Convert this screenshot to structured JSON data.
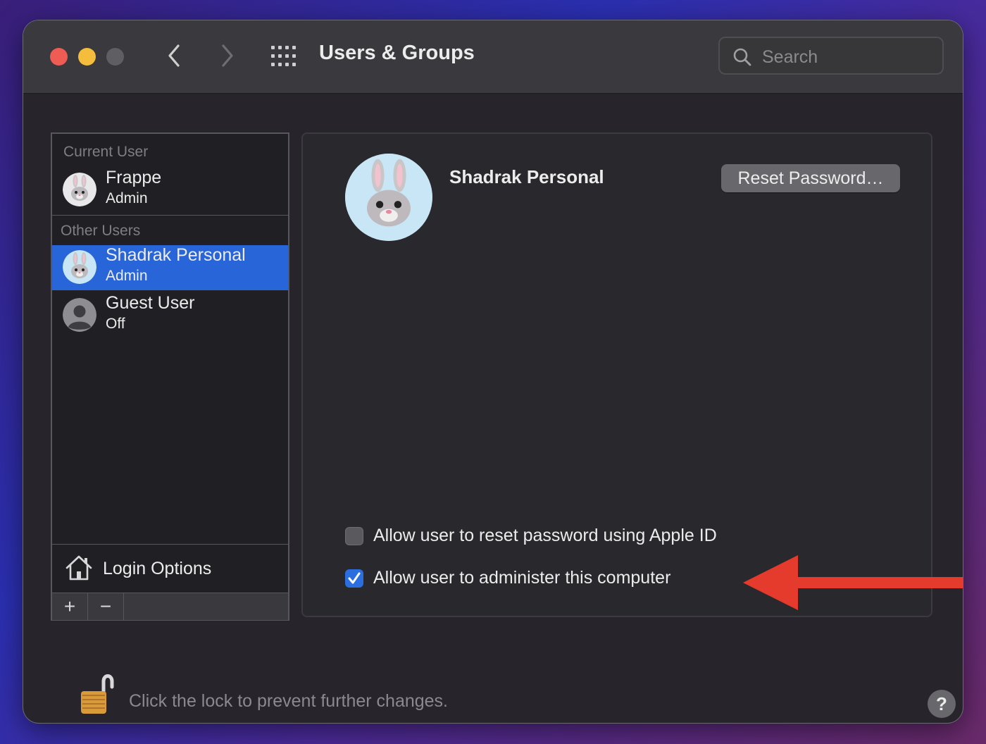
{
  "window": {
    "title": "Users & Groups"
  },
  "toolbar": {
    "back_icon": "chevron-left-icon",
    "forward_icon": "chevron-right-icon",
    "show_all_icon": "grid-icon"
  },
  "search": {
    "placeholder": "Search",
    "value": ""
  },
  "sidebar": {
    "current_user_label": "Current User",
    "other_users_label": "Other Users",
    "current_user": {
      "name": "Frappe",
      "role": "Admin"
    },
    "other_users": [
      {
        "name": "Shadrak Personal",
        "role": "Admin",
        "selected": true
      },
      {
        "name": "Guest User",
        "role": "Off",
        "selected": false
      }
    ],
    "login_options_label": "Login Options",
    "add_label": "+",
    "remove_label": "−"
  },
  "detail": {
    "user_name": "Shadrak Personal",
    "reset_password_label": "Reset Password…",
    "options": [
      {
        "label": "Allow user to reset password using Apple ID",
        "checked": false
      },
      {
        "label": "Allow user to administer this computer",
        "checked": true
      }
    ]
  },
  "footer": {
    "lock_text": "Click the lock to prevent further changes.",
    "help_label": "?"
  },
  "colors": {
    "accent": "#2865d8",
    "window_bg": "#27252b",
    "annotation_arrow": "#e53b2c",
    "close": "#ee5c54",
    "minimize": "#f4bd3c"
  }
}
